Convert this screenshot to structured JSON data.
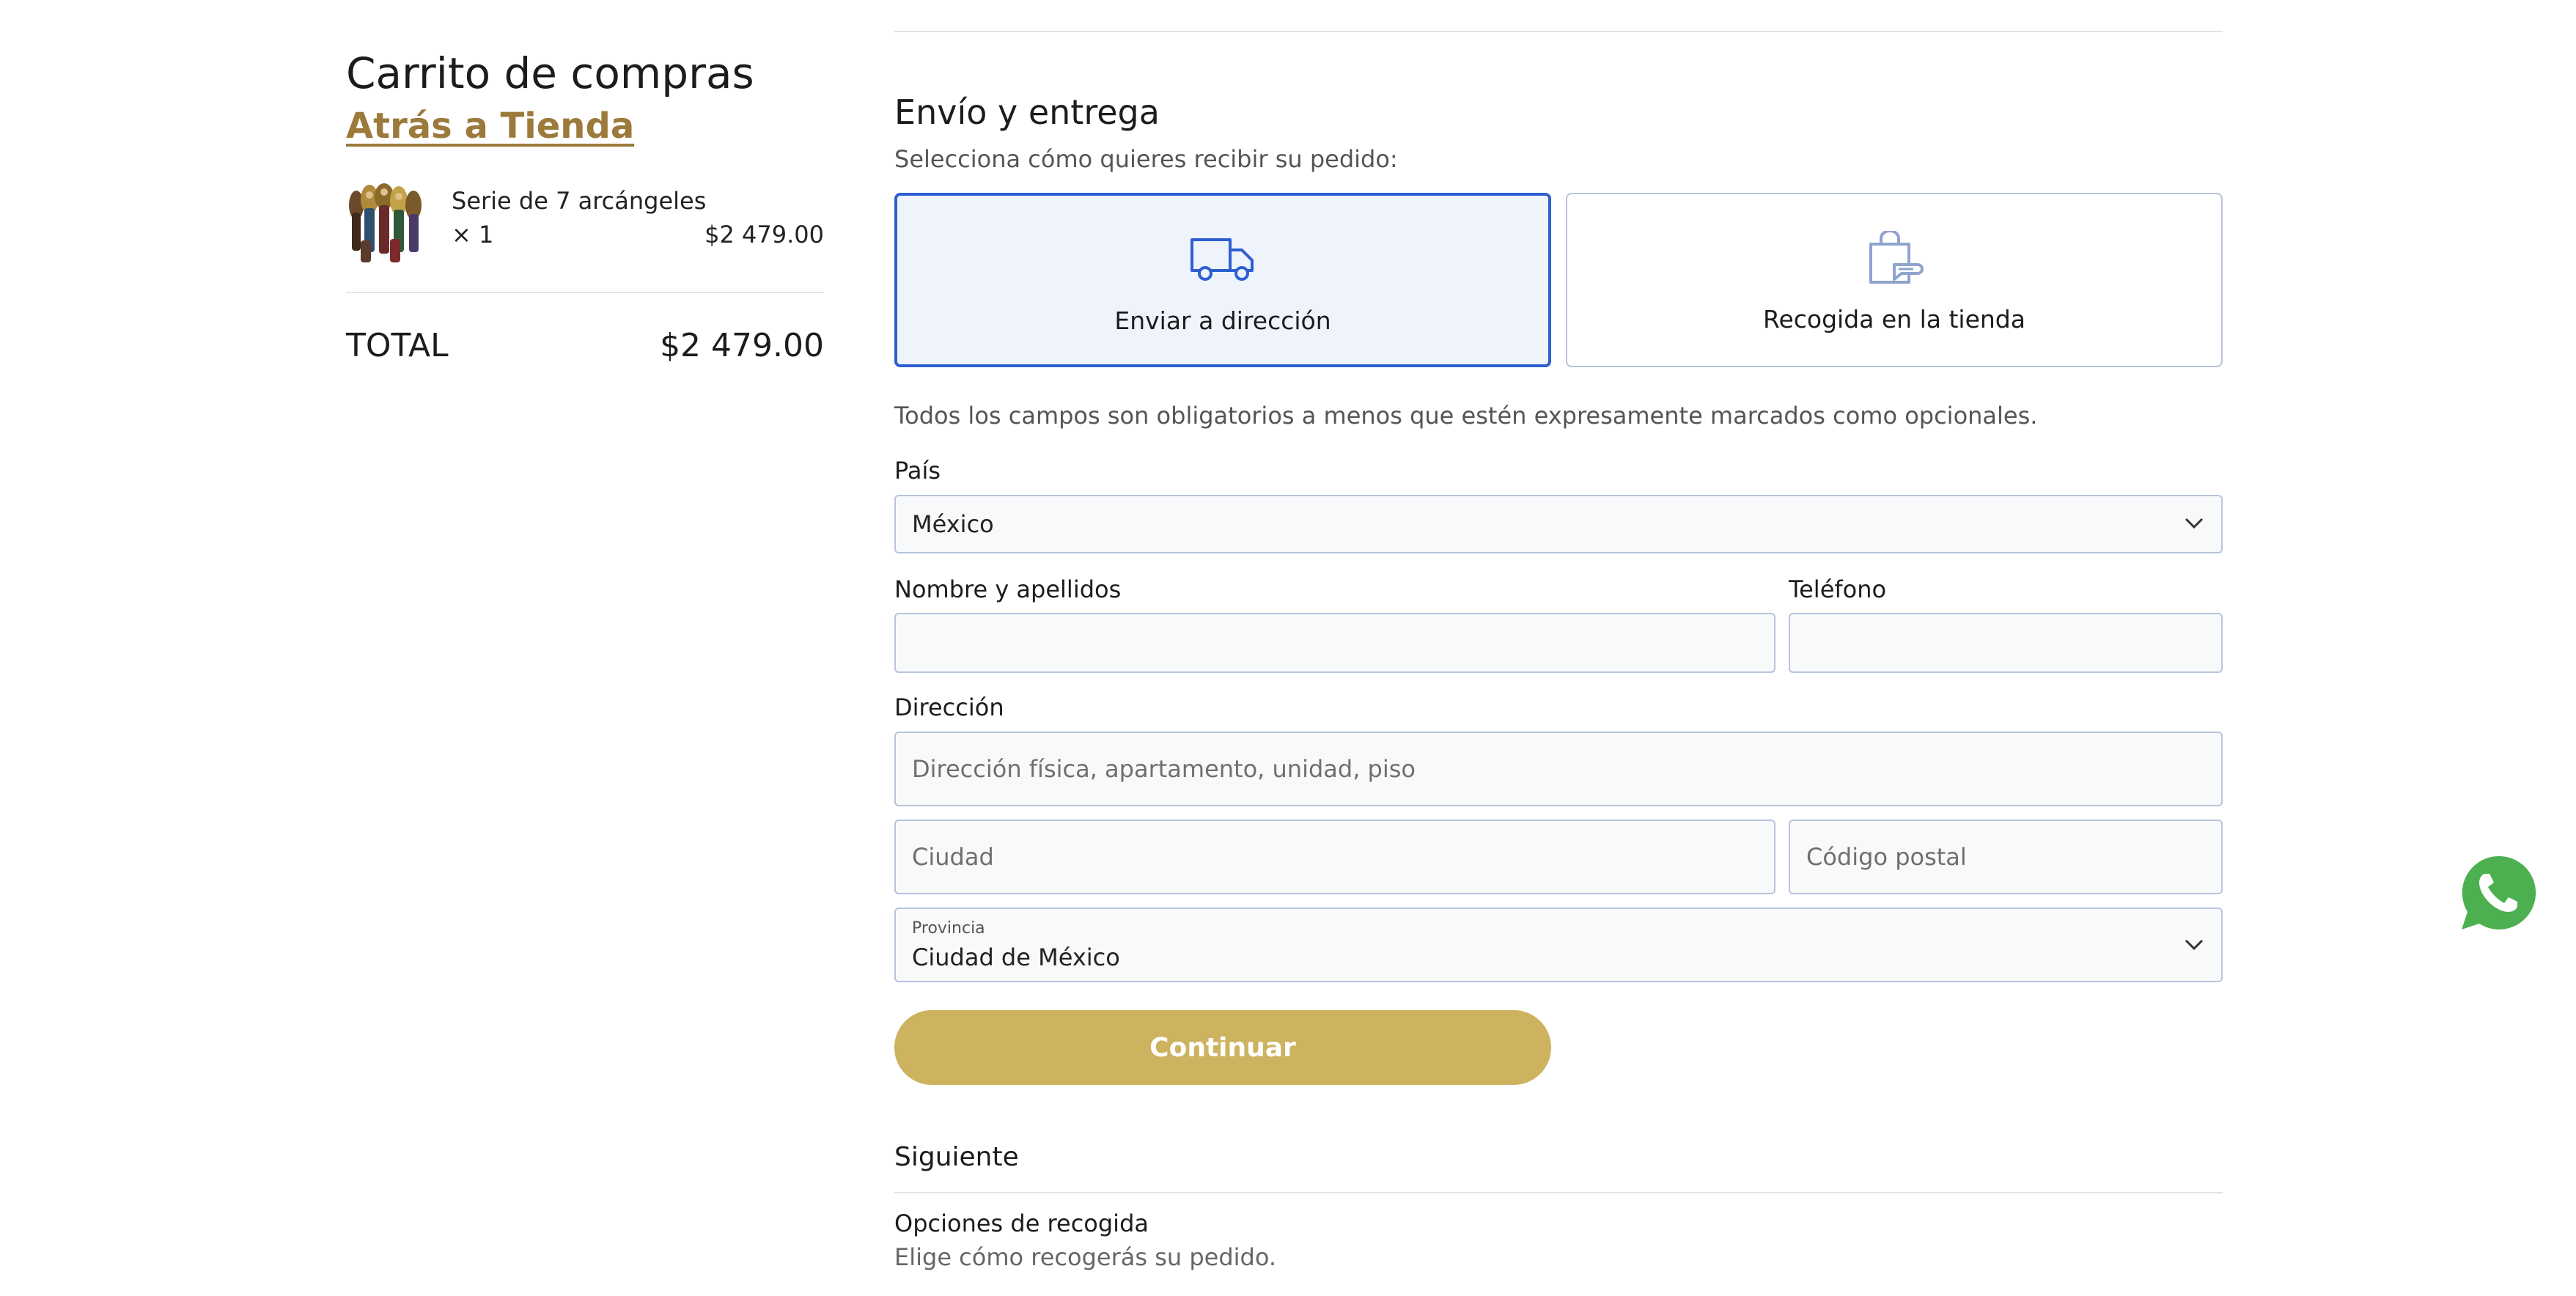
{
  "cart": {
    "title": "Carrito de compras",
    "back_link": "Atrás a Tienda",
    "items": [
      {
        "name": "Serie de 7 arcángeles",
        "quantity": "× 1",
        "price": "$2 479.00",
        "thumbnail_icon": "product-thumbnail"
      }
    ],
    "total_label": "TOTAL",
    "total_value": "$2 479.00"
  },
  "shipping": {
    "title": "Envío y entrega",
    "subtitle": "Selecciona cómo quieres recibir su pedido:",
    "options": [
      {
        "label": "Enviar a dirección",
        "icon": "truck-icon",
        "selected": true
      },
      {
        "label": "Recogida en la tienda",
        "icon": "shopping-bag-icon",
        "selected": false
      }
    ],
    "required_note": "Todos los campos son obligatorios a menos que estén expresamente marcados como opcionales."
  },
  "form": {
    "country_label": "País",
    "country_value": "México",
    "name_label": "Nombre y apellidos",
    "name_value": "",
    "phone_label": "Teléfono",
    "phone_value": "",
    "address_label": "Dirección",
    "address_placeholder": "Dirección física, apartamento, unidad, piso",
    "city_placeholder": "Ciudad",
    "postal_placeholder": "Código postal",
    "province_label": "Provincia",
    "province_value": "Ciudad de México",
    "continue_label": "Continuar"
  },
  "next_step": {
    "title": "Siguiente",
    "item_title": "Opciones de recogida",
    "item_desc": "Elige cómo recogerás su pedido."
  },
  "colors": {
    "accent_gold": "#cdb35f",
    "link_gold": "#9c7a3c",
    "selected_blue": "#2e5fd1",
    "whatsapp_green": "#4caf50"
  },
  "floating": {
    "whatsapp_icon": "whatsapp-icon"
  }
}
